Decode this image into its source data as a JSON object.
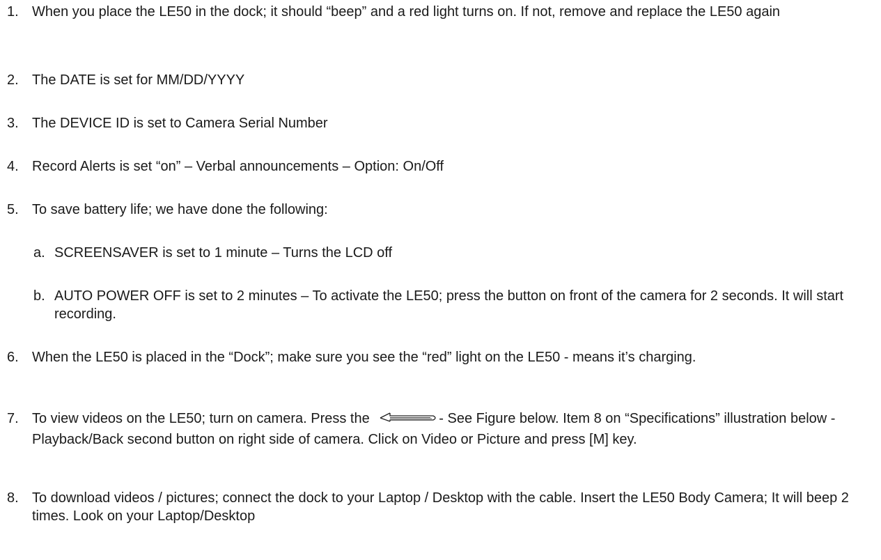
{
  "items": [
    {
      "num": "1.",
      "text": "When you place the LE50 in the dock; it should “beep” and a red light turns on. If not, remove and replace the LE50 again"
    },
    {
      "num": "2.",
      "text": "The DATE is set for MM/DD/YYYY"
    },
    {
      "num": "3.",
      "text": "The DEVICE ID is set to Camera Serial Number"
    },
    {
      "num": "4.",
      "text": "Record Alerts is set “on” – Verbal announcements – Option: On/Off"
    },
    {
      "num": "5.",
      "text": "To save battery life; we have done the following:"
    },
    {
      "num": "a.",
      "text": "SCREENSAVER is set to 1 minute – Turns the LCD off"
    },
    {
      "num": "b.",
      "text": "AUTO POWER OFF is set to 2 minutes – To activate the LE50; press the button on front of the camera for 2 seconds.  It will start recording."
    },
    {
      "num": "6.",
      "text": "When the LE50 is placed in the “Dock”; make sure you see the “red” light on the LE50 - means it’s charging."
    },
    {
      "num": "7.",
      "text_before": "To view videos on the LE50; turn on camera. Press the",
      "text_after": "- See Figure below. Item 8 on “Specifications” illustration below - Playback/Back second button on right side of camera. Click on Video or Picture and press [M] key."
    },
    {
      "num": "8.",
      "text": "To download videos / pictures; connect the dock to your Laptop / Desktop with the cable.  Insert the LE50 Body Camera; It will beep 2 times.  Look on your Laptop/Desktop"
    }
  ],
  "icons": {
    "playback": "back-arrow-icon"
  }
}
